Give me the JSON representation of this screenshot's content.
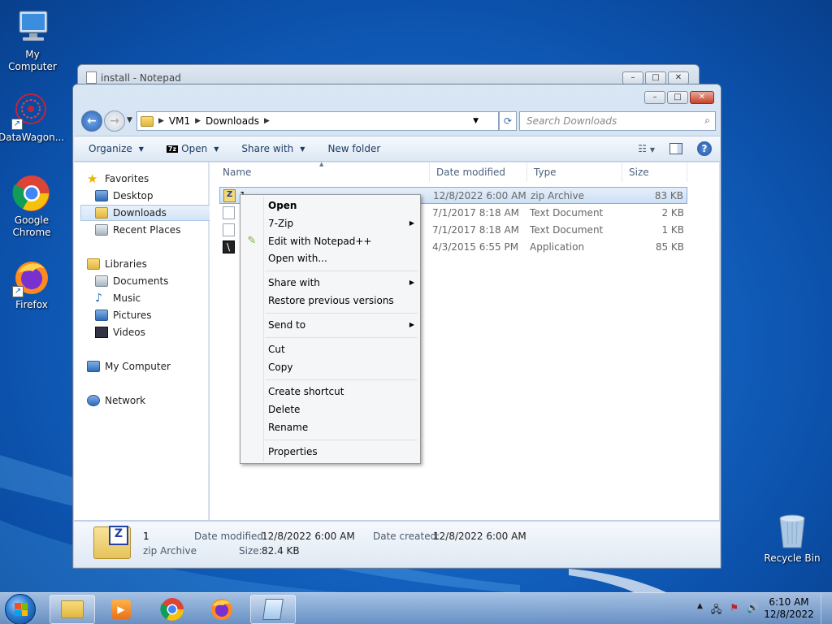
{
  "desktop": {
    "icons": [
      {
        "label": "My Computer",
        "icon": "computer-icon"
      },
      {
        "label": "DataWagon...",
        "icon": "datawagon-icon"
      },
      {
        "label": "Google Chrome",
        "icon": "chrome-icon"
      },
      {
        "label": "Firefox",
        "icon": "firefox-icon"
      },
      {
        "label": "Recycle Bin",
        "icon": "recycle-bin-icon"
      }
    ]
  },
  "notepad": {
    "title": "install - Notepad"
  },
  "explorer": {
    "window_buttons": {
      "minimize": "–",
      "maximize": "□",
      "close": "✕"
    },
    "address": {
      "segments": [
        "VM1",
        "Downloads"
      ]
    },
    "search": {
      "placeholder": "Search Downloads"
    },
    "toolbar": {
      "organize": "Organize",
      "open": "Open",
      "share_with": "Share with",
      "new_folder": "New folder",
      "help": "?"
    },
    "nav": {
      "favorites": {
        "label": "Favorites",
        "items": [
          "Desktop",
          "Downloads",
          "Recent Places"
        ]
      },
      "libraries": {
        "label": "Libraries",
        "items": [
          "Documents",
          "Music",
          "Pictures",
          "Videos"
        ]
      },
      "computer": "My Computer",
      "network": "Network"
    },
    "columns": [
      "Name",
      "Date modified",
      "Type",
      "Size"
    ],
    "files": [
      {
        "name": "1",
        "date": "12/8/2022 6:00 AM",
        "type": "zip Archive",
        "size": "83 KB",
        "icon": "zip"
      },
      {
        "name": "",
        "date": "7/1/2017 8:18 AM",
        "type": "Text Document",
        "size": "2 KB",
        "icon": "txt"
      },
      {
        "name": "",
        "date": "7/1/2017 8:18 AM",
        "type": "Text Document",
        "size": "1 KB",
        "icon": "txt"
      },
      {
        "name": "",
        "date": "4/3/2015 6:55 PM",
        "type": "Application",
        "size": "85 KB",
        "icon": "app"
      }
    ],
    "details": {
      "name": "1",
      "type": "zip Archive",
      "date_modified_label": "Date modified:",
      "date_modified": "12/8/2022 6:00 AM",
      "date_created_label": "Date created:",
      "date_created": "12/8/2022 6:00 AM",
      "size_label": "Size:",
      "size": "82.4 KB"
    }
  },
  "context_menu": {
    "open": "Open",
    "zip7": "7-Zip",
    "edit_npp": "Edit with Notepad++",
    "open_with": "Open with...",
    "share_with": "Share with",
    "restore": "Restore previous versions",
    "send_to": "Send to",
    "cut": "Cut",
    "copy": "Copy",
    "create_shortcut": "Create shortcut",
    "delete": "Delete",
    "rename": "Rename",
    "properties": "Properties"
  },
  "taskbar": {
    "clock_time": "6:10 AM",
    "clock_date": "12/8/2022",
    "apps": [
      "explorer-icon",
      "media-player-icon",
      "chrome-icon",
      "firefox-icon",
      "notepad-icon"
    ]
  }
}
